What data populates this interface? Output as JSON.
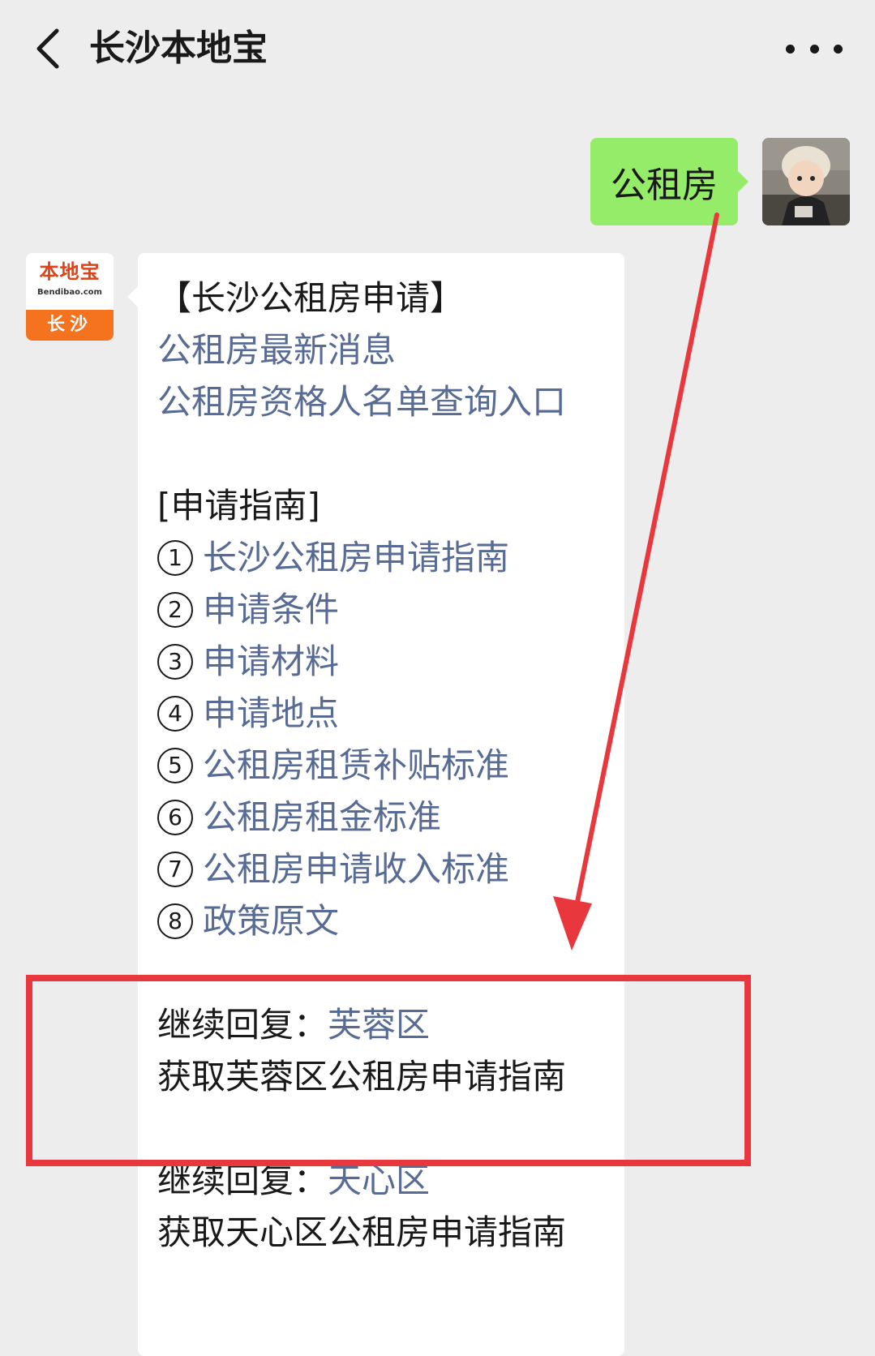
{
  "nav": {
    "title": "长沙本地宝"
  },
  "user_message": {
    "text": "公租房"
  },
  "account_avatar": {
    "logo_name": "本地宝",
    "logo_site": "Bendibao.com",
    "logo_city": "长沙"
  },
  "reply": {
    "heading": "【长沙公租房申请】",
    "links": [
      "公租房最新消息",
      "公租房资格人名单查询入口"
    ],
    "guide_heading": "[申请指南]",
    "guide_items": [
      {
        "num": "1",
        "label": "长沙公租房申请指南"
      },
      {
        "num": "2",
        "label": "申请条件"
      },
      {
        "num": "3",
        "label": "申请材料"
      },
      {
        "num": "4",
        "label": "申请地点"
      },
      {
        "num": "5",
        "label": "公租房租赁补贴标准"
      },
      {
        "num": "6",
        "label": "公租房租金标准"
      },
      {
        "num": "7",
        "label": "公租房申请收入标准"
      },
      {
        "num": "8",
        "label": "政策原文"
      }
    ],
    "districts": [
      {
        "prefix": "继续回复：",
        "keyword": "芙蓉区",
        "description": "获取芙蓉区公租房申请指南"
      },
      {
        "prefix": "继续回复：",
        "keyword": "天心区",
        "description": "获取天心区公租房申请指南"
      }
    ]
  },
  "colors": {
    "background": "#ededed",
    "user_bubble": "#95ec69",
    "link": "#576b95",
    "annotation": "#e8383d",
    "brand_orange": "#f5731e"
  },
  "icons": {
    "back": "chevron-left-icon",
    "more": "more-dots-icon"
  }
}
